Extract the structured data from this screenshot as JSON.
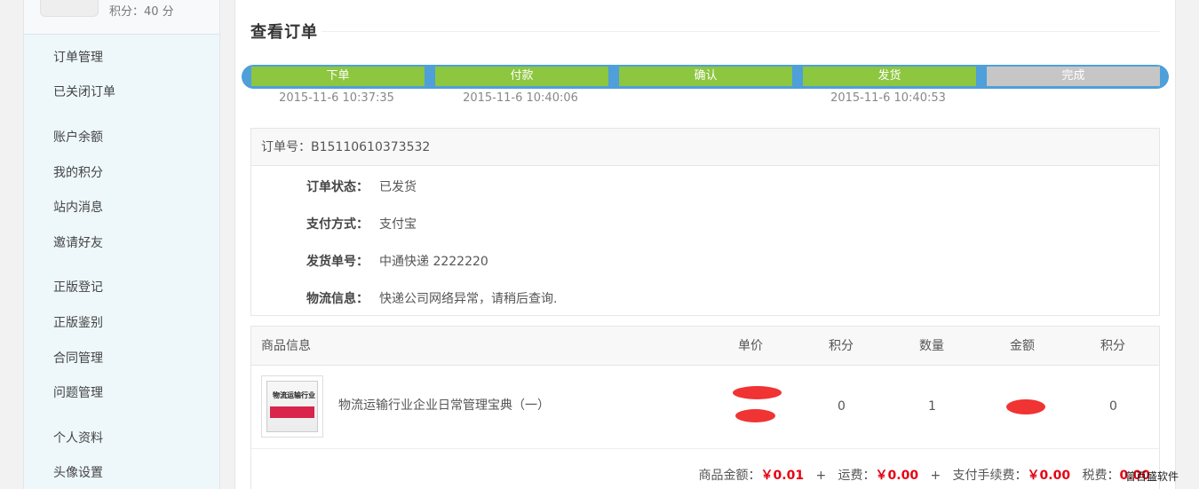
{
  "user": {
    "points_text": "积分：40 分"
  },
  "sidebar": {
    "group1": [
      "订单管理",
      "已关闭订单"
    ],
    "group2": [
      "账户余额",
      "我的积分",
      "站内消息",
      "邀请好友"
    ],
    "group3": [
      "正版登记",
      "正版鉴别",
      "合同管理",
      "问题管理"
    ],
    "group4": [
      "个人资料",
      "头像设置"
    ]
  },
  "page": {
    "title": "查看订单"
  },
  "progress": {
    "steps": [
      {
        "label": "下单",
        "date": "2015-11-6 10:37:35",
        "status": "done"
      },
      {
        "label": "付款",
        "date": "2015-11-6 10:40:06",
        "status": "done"
      },
      {
        "label": "确认",
        "date": "",
        "status": "done"
      },
      {
        "label": "发货",
        "date": "2015-11-6 10:40:53",
        "status": "done"
      },
      {
        "label": "完成",
        "date": "",
        "status": "todo"
      }
    ],
    "colors": {
      "track": "#4e9fda",
      "done": "#8dc63f",
      "todo": "#c6c6c6"
    }
  },
  "order": {
    "number_text": "订单号：B15110610373532",
    "status_label": "订单状态：",
    "status_value": "已发货",
    "payment_label": "支付方式：",
    "payment_value": "支付宝",
    "shipping_label": "发货单号：",
    "shipping_value": "中通快递 2222220",
    "logistics_label": "物流信息：",
    "logistics_value": "快递公司网络异常，请稍后查询."
  },
  "goods": {
    "headers": {
      "info": "商品信息",
      "unit_price": "单价",
      "points": "积分",
      "quantity": "数量",
      "amount": "金额",
      "points2": "积分"
    },
    "items": [
      {
        "name": "物流运输行业企业日常管理宝典（一）",
        "points": "0",
        "quantity": "1",
        "points2": "0",
        "cover_title": "物流运输行业"
      }
    ],
    "totals": {
      "goods_label": "商品金额：",
      "goods_value": "￥0.01",
      "plus": "+",
      "freight_label": "运费：",
      "freight_value": "￥0.00",
      "fee_label": "支付手续费：",
      "fee_value": "￥0.00",
      "tax_label": "税费：",
      "tax_value": "0.00"
    }
  },
  "watermark": "曾百盛软件"
}
